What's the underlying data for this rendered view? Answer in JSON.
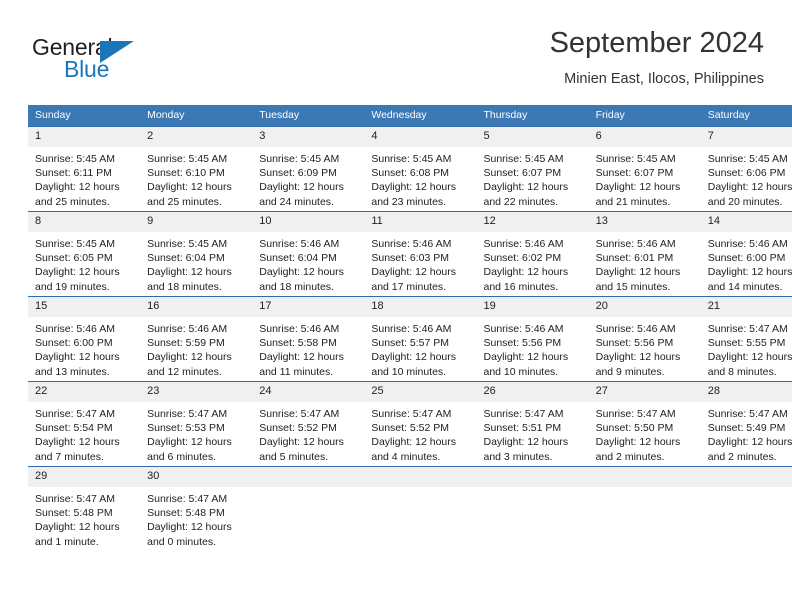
{
  "brand": {
    "name_part1": "General",
    "name_part2": "Blue",
    "triangle_color": "#1b75bb"
  },
  "header": {
    "title": "September 2024",
    "subtitle": "Minien East, Ilocos, Philippines"
  },
  "theme": {
    "header_bg": "#3c78b4",
    "row_border": "#2f6cad",
    "daynum_bg": "#f0f0f0"
  },
  "weekday_headers": [
    "Sunday",
    "Monday",
    "Tuesday",
    "Wednesday",
    "Thursday",
    "Friday",
    "Saturday"
  ],
  "weeks": [
    [
      {
        "day": "1",
        "sunrise": "Sunrise: 5:45 AM",
        "sunset": "Sunset: 6:11 PM",
        "daylight": "Daylight: 12 hours and 25 minutes."
      },
      {
        "day": "2",
        "sunrise": "Sunrise: 5:45 AM",
        "sunset": "Sunset: 6:10 PM",
        "daylight": "Daylight: 12 hours and 25 minutes."
      },
      {
        "day": "3",
        "sunrise": "Sunrise: 5:45 AM",
        "sunset": "Sunset: 6:09 PM",
        "daylight": "Daylight: 12 hours and 24 minutes."
      },
      {
        "day": "4",
        "sunrise": "Sunrise: 5:45 AM",
        "sunset": "Sunset: 6:08 PM",
        "daylight": "Daylight: 12 hours and 23 minutes."
      },
      {
        "day": "5",
        "sunrise": "Sunrise: 5:45 AM",
        "sunset": "Sunset: 6:07 PM",
        "daylight": "Daylight: 12 hours and 22 minutes."
      },
      {
        "day": "6",
        "sunrise": "Sunrise: 5:45 AM",
        "sunset": "Sunset: 6:07 PM",
        "daylight": "Daylight: 12 hours and 21 minutes."
      },
      {
        "day": "7",
        "sunrise": "Sunrise: 5:45 AM",
        "sunset": "Sunset: 6:06 PM",
        "daylight": "Daylight: 12 hours and 20 minutes."
      }
    ],
    [
      {
        "day": "8",
        "sunrise": "Sunrise: 5:45 AM",
        "sunset": "Sunset: 6:05 PM",
        "daylight": "Daylight: 12 hours and 19 minutes."
      },
      {
        "day": "9",
        "sunrise": "Sunrise: 5:45 AM",
        "sunset": "Sunset: 6:04 PM",
        "daylight": "Daylight: 12 hours and 18 minutes."
      },
      {
        "day": "10",
        "sunrise": "Sunrise: 5:46 AM",
        "sunset": "Sunset: 6:04 PM",
        "daylight": "Daylight: 12 hours and 18 minutes."
      },
      {
        "day": "11",
        "sunrise": "Sunrise: 5:46 AM",
        "sunset": "Sunset: 6:03 PM",
        "daylight": "Daylight: 12 hours and 17 minutes."
      },
      {
        "day": "12",
        "sunrise": "Sunrise: 5:46 AM",
        "sunset": "Sunset: 6:02 PM",
        "daylight": "Daylight: 12 hours and 16 minutes."
      },
      {
        "day": "13",
        "sunrise": "Sunrise: 5:46 AM",
        "sunset": "Sunset: 6:01 PM",
        "daylight": "Daylight: 12 hours and 15 minutes."
      },
      {
        "day": "14",
        "sunrise": "Sunrise: 5:46 AM",
        "sunset": "Sunset: 6:00 PM",
        "daylight": "Daylight: 12 hours and 14 minutes."
      }
    ],
    [
      {
        "day": "15",
        "sunrise": "Sunrise: 5:46 AM",
        "sunset": "Sunset: 6:00 PM",
        "daylight": "Daylight: 12 hours and 13 minutes."
      },
      {
        "day": "16",
        "sunrise": "Sunrise: 5:46 AM",
        "sunset": "Sunset: 5:59 PM",
        "daylight": "Daylight: 12 hours and 12 minutes."
      },
      {
        "day": "17",
        "sunrise": "Sunrise: 5:46 AM",
        "sunset": "Sunset: 5:58 PM",
        "daylight": "Daylight: 12 hours and 11 minutes."
      },
      {
        "day": "18",
        "sunrise": "Sunrise: 5:46 AM",
        "sunset": "Sunset: 5:57 PM",
        "daylight": "Daylight: 12 hours and 10 minutes."
      },
      {
        "day": "19",
        "sunrise": "Sunrise: 5:46 AM",
        "sunset": "Sunset: 5:56 PM",
        "daylight": "Daylight: 12 hours and 10 minutes."
      },
      {
        "day": "20",
        "sunrise": "Sunrise: 5:46 AM",
        "sunset": "Sunset: 5:56 PM",
        "daylight": "Daylight: 12 hours and 9 minutes."
      },
      {
        "day": "21",
        "sunrise": "Sunrise: 5:47 AM",
        "sunset": "Sunset: 5:55 PM",
        "daylight": "Daylight: 12 hours and 8 minutes."
      }
    ],
    [
      {
        "day": "22",
        "sunrise": "Sunrise: 5:47 AM",
        "sunset": "Sunset: 5:54 PM",
        "daylight": "Daylight: 12 hours and 7 minutes."
      },
      {
        "day": "23",
        "sunrise": "Sunrise: 5:47 AM",
        "sunset": "Sunset: 5:53 PM",
        "daylight": "Daylight: 12 hours and 6 minutes."
      },
      {
        "day": "24",
        "sunrise": "Sunrise: 5:47 AM",
        "sunset": "Sunset: 5:52 PM",
        "daylight": "Daylight: 12 hours and 5 minutes."
      },
      {
        "day": "25",
        "sunrise": "Sunrise: 5:47 AM",
        "sunset": "Sunset: 5:52 PM",
        "daylight": "Daylight: 12 hours and 4 minutes."
      },
      {
        "day": "26",
        "sunrise": "Sunrise: 5:47 AM",
        "sunset": "Sunset: 5:51 PM",
        "daylight": "Daylight: 12 hours and 3 minutes."
      },
      {
        "day": "27",
        "sunrise": "Sunrise: 5:47 AM",
        "sunset": "Sunset: 5:50 PM",
        "daylight": "Daylight: 12 hours and 2 minutes."
      },
      {
        "day": "28",
        "sunrise": "Sunrise: 5:47 AM",
        "sunset": "Sunset: 5:49 PM",
        "daylight": "Daylight: 12 hours and 2 minutes."
      }
    ],
    [
      {
        "day": "29",
        "sunrise": "Sunrise: 5:47 AM",
        "sunset": "Sunset: 5:48 PM",
        "daylight": "Daylight: 12 hours and 1 minute."
      },
      {
        "day": "30",
        "sunrise": "Sunrise: 5:47 AM",
        "sunset": "Sunset: 5:48 PM",
        "daylight": "Daylight: 12 hours and 0 minutes."
      },
      {
        "day": "",
        "sunrise": "",
        "sunset": "",
        "daylight": ""
      },
      {
        "day": "",
        "sunrise": "",
        "sunset": "",
        "daylight": ""
      },
      {
        "day": "",
        "sunrise": "",
        "sunset": "",
        "daylight": ""
      },
      {
        "day": "",
        "sunrise": "",
        "sunset": "",
        "daylight": ""
      },
      {
        "day": "",
        "sunrise": "",
        "sunset": "",
        "daylight": ""
      }
    ]
  ]
}
